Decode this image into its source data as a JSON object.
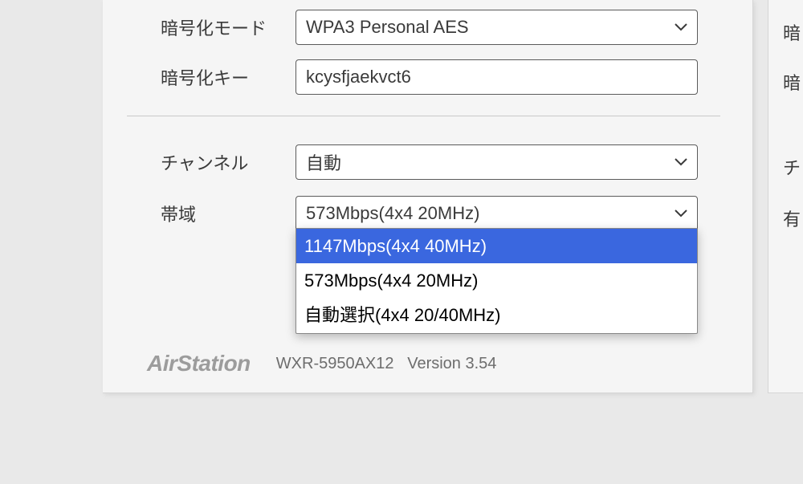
{
  "form": {
    "encryption_mode": {
      "label": "暗号化モード",
      "value": "WPA3 Personal AES"
    },
    "encryption_key": {
      "label": "暗号化キー",
      "value": "kcysfjaekvct6"
    },
    "channel": {
      "label": "チャンネル",
      "value": "自動"
    },
    "bandwidth": {
      "label": "帯域",
      "value": "573Mbps(4x4 20MHz)",
      "options": [
        "1147Mbps(4x4 40MHz)",
        "573Mbps(4x4 20MHz)",
        "自動選択(4x4 20/40MHz)"
      ],
      "highlighted_index": 0
    }
  },
  "right_labels": [
    "暗",
    "暗",
    "チ",
    "有"
  ],
  "footer": {
    "brand": "AirStation",
    "model": "WXR-5950AX12",
    "version": "Version 3.54"
  }
}
